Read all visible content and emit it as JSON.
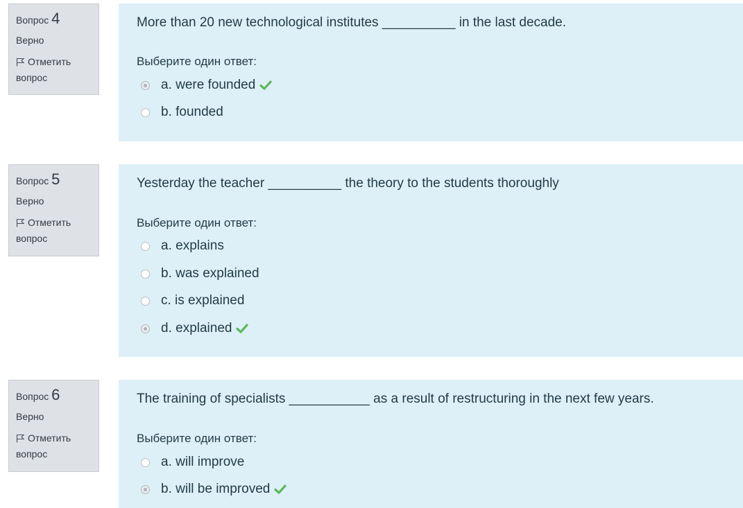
{
  "questions": [
    {
      "label": "Вопрос",
      "number": "4",
      "state": "Верно",
      "flag_label_1": "Отметить",
      "flag_label_2": "вопрос",
      "text": "More than 20 new technological institutes __________ in the last decade.",
      "prompt": "Выберите один ответ:",
      "options": [
        {
          "label": "a. were founded",
          "selected": true,
          "correct": true
        },
        {
          "label": "b. founded",
          "selected": false,
          "correct": false
        }
      ]
    },
    {
      "label": "Вопрос",
      "number": "5",
      "state": "Верно",
      "flag_label_1": "Отметить",
      "flag_label_2": "вопрос",
      "text": "Yesterday the teacher __________  the theory to the students  thoroughly",
      "prompt": "Выберите один ответ:",
      "options": [
        {
          "label": "a. explains",
          "selected": false,
          "correct": false
        },
        {
          "label": "b. was explained",
          "selected": false,
          "correct": false
        },
        {
          "label": "c. is explained",
          "selected": false,
          "correct": false
        },
        {
          "label": "d. explained",
          "selected": true,
          "correct": true
        }
      ]
    },
    {
      "label": "Вопрос",
      "number": "6",
      "state": "Верно",
      "flag_label_1": "Отметить",
      "flag_label_2": "вопрос",
      "text": "The training of specialists ___________ as a result of restructuring in the next few years.",
      "prompt": "Выберите один ответ:",
      "options": [
        {
          "label": "a. will improve",
          "selected": false,
          "correct": false
        },
        {
          "label": "b. will be improved",
          "selected": true,
          "correct": true
        }
      ]
    }
  ],
  "colors": {
    "info_bg": "#dee2e6",
    "content_bg": "#def0f7",
    "check": "#5cb85c"
  },
  "icons": {
    "flag": "flag-icon",
    "correct": "check-icon"
  }
}
